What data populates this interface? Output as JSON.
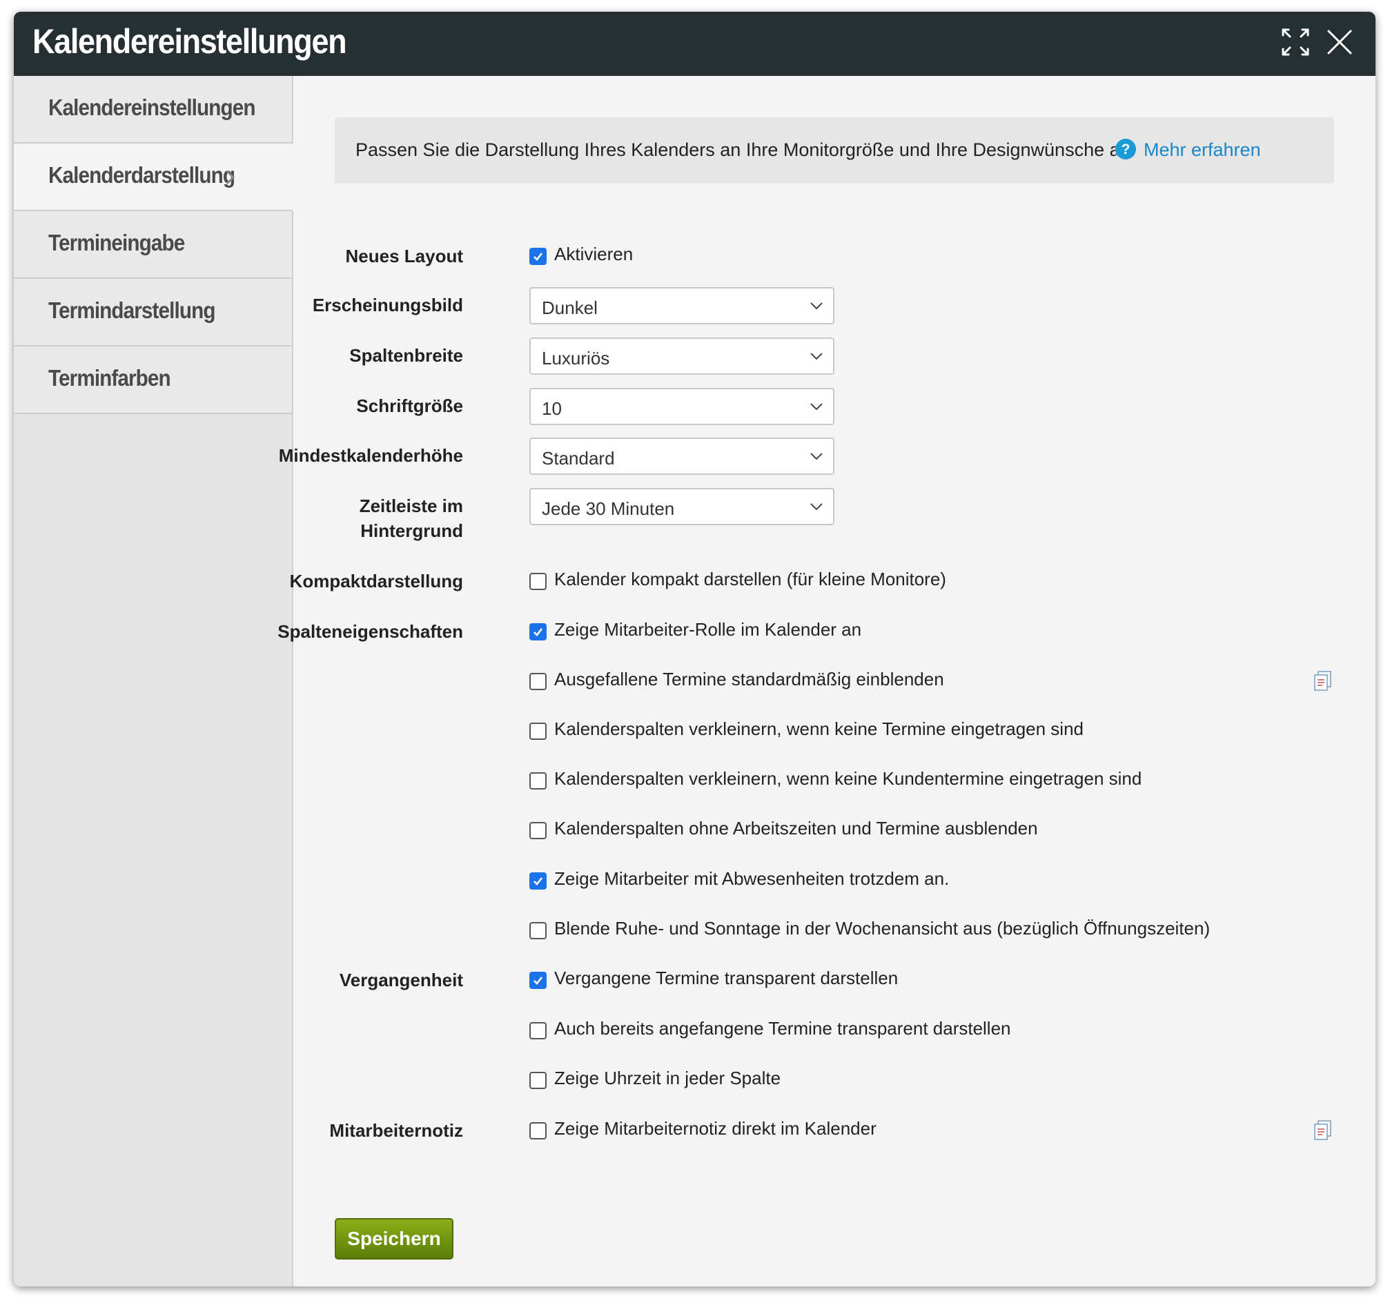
{
  "dialog": {
    "title": "Kalendereinstellungen"
  },
  "titlebar_icons": {
    "maximize": "expand-arrows-icon",
    "close": "close-x-icon"
  },
  "sidebar": {
    "items": [
      {
        "label": "Kalendereinstellungen",
        "active": false
      },
      {
        "label": "Kalenderdarstellung",
        "active": true
      },
      {
        "label": "Termineingabe",
        "active": false
      },
      {
        "label": "Termindarstellung",
        "active": false
      },
      {
        "label": "Terminfarben",
        "active": false
      }
    ]
  },
  "info": {
    "text": "Passen Sie die Darstellung Ihres Kalenders an Ihre Monitorgröße und Ihre Designwünsche an.",
    "link": "Mehr erfahren"
  },
  "settings": {
    "neues_layout": {
      "label": "Neues Layout",
      "checkbox": "Aktivieren",
      "checked": true
    },
    "erscheinungsbild": {
      "label": "Erscheinungsbild",
      "value": "Dunkel"
    },
    "spaltenbreite": {
      "label": "Spaltenbreite",
      "value": "Luxuriös"
    },
    "schriftgroesse": {
      "label": "Schriftgröße",
      "value": "10"
    },
    "mindesthoehe": {
      "label": "Mindestkalenderhöhe",
      "value": "Standard"
    },
    "zeitleiste": {
      "label_line1": "Zeitleiste im",
      "label_line2": "Hintergrund",
      "value": "Jede 30 Minuten"
    },
    "kompakt": {
      "label": "Kompaktdarstellung",
      "checkbox": "Kalender kompakt darstellen (für kleine Monitore)",
      "checked": false
    },
    "spalten": {
      "label": "Spalteneigenschaften",
      "options": [
        {
          "text": "Zeige Mitarbeiter-Rolle im Kalender an",
          "checked": true
        },
        {
          "text": "Ausgefallene Termine standardmäßig einblenden",
          "checked": false
        },
        {
          "text": "Kalenderspalten verkleinern, wenn keine Termine eingetragen sind",
          "checked": false
        },
        {
          "text": "Kalenderspalten verkleinern, wenn keine Kundentermine eingetragen sind",
          "checked": false
        },
        {
          "text": "Kalenderspalten ohne Arbeitszeiten und Termine ausblenden",
          "checked": false
        },
        {
          "text": "Zeige Mitarbeiter mit Abwesenheiten trotzdem an.",
          "checked": true
        },
        {
          "text": "Blende Ruhe- und Sonntage in der Wochenansicht aus (bezüglich Öffnungszeiten)",
          "checked": false
        }
      ]
    },
    "vergangenheit": {
      "label": "Vergangenheit",
      "options": [
        {
          "text": "Vergangene Termine transparent darstellen",
          "checked": true
        },
        {
          "text": "Auch bereits angefangene Termine transparent darstellen",
          "checked": false
        },
        {
          "text": "Zeige Uhrzeit in jeder Spalte",
          "checked": false
        }
      ]
    },
    "mitarbeiternotiz": {
      "label": "Mitarbeiternotiz",
      "checkbox": "Zeige Mitarbeiternotiz direkt im Kalender",
      "checked": false
    }
  },
  "save_button": "Speichern",
  "colors": {
    "titlebar": "#263033",
    "checkbox_checked": "#1a73e8",
    "link": "#1a87c8",
    "save_button": "#6e9410"
  }
}
